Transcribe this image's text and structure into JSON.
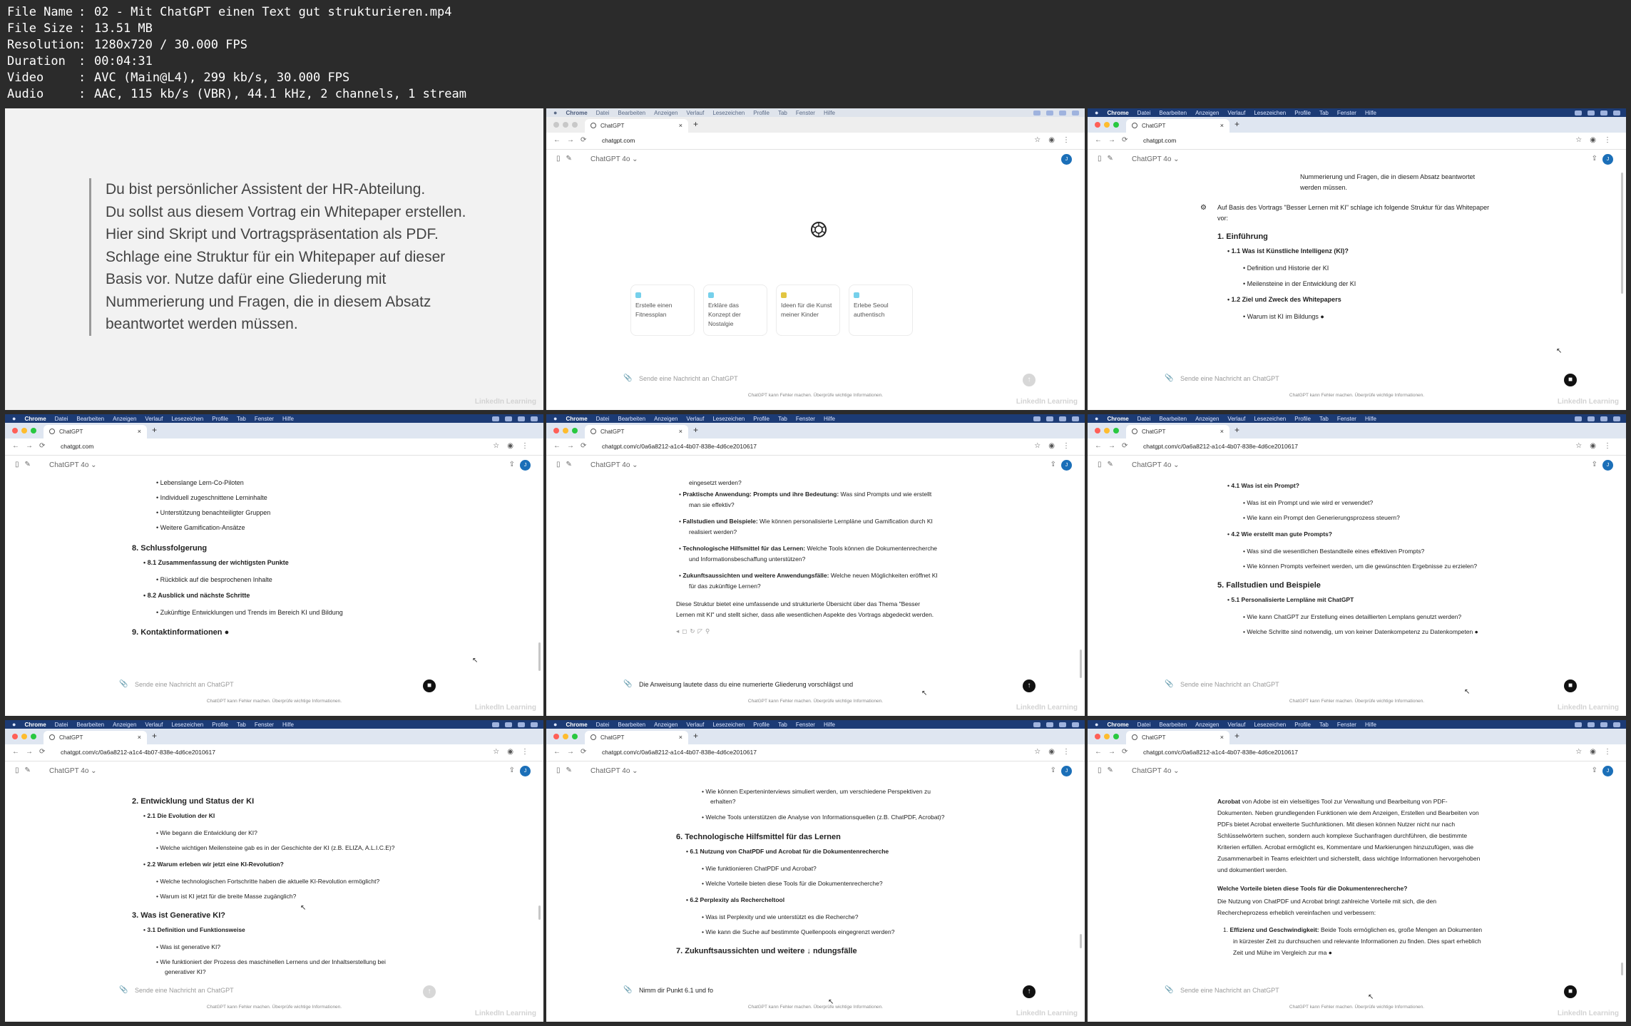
{
  "file_info": [
    {
      "key": "File Name",
      "value": "02 - Mit ChatGPT einen Text gut strukturieren.mp4"
    },
    {
      "key": "File Size",
      "value": "13.51 MB"
    },
    {
      "key": "Resolution",
      "value": "1280x720 / 30.000 FPS"
    },
    {
      "key": "Duration",
      "value": "00:04:31"
    },
    {
      "key": "Video",
      "value": "AVC (Main@L4), 299 kb/s, 30.000 FPS"
    },
    {
      "key": "Audio",
      "value": "AAC, 115 kb/s (VBR), 44.1 kHz, 2 channels, 1 stream"
    }
  ],
  "slide": {
    "lines": [
      "Du bist persönlicher Assistent der HR-Abteilung.",
      "Du sollst aus diesem Vortrag ein Whitepaper erstellen.",
      "Hier sind Skript und Vortragspräsentation als PDF.",
      "Schlage eine Struktur für ein Whitepaper auf dieser",
      "Basis vor. Nutze dafür eine Gliederung mit",
      "Nummerierung und Fragen, die in diesem Absatz",
      "beantwortet werden müssen."
    ]
  },
  "common": {
    "menubar": {
      "app": "Chrome",
      "items": [
        "Datei",
        "Bearbeiten",
        "Anzeigen",
        "Verlauf",
        "Lesezeichen",
        "Profile",
        "Tab",
        "Fenster",
        "Hilfe"
      ]
    },
    "tab_title": "ChatGPT",
    "model": "ChatGPT 4o",
    "avatar": "J",
    "placeholder": "Sende eine Nachricht an ChatGPT",
    "disclaimer": "ChatGPT kann Fehler machen. Überprüfe wichtige Informationen.",
    "watermark": "LinkedIn Learning",
    "url_home": "chatgpt.com",
    "url_chat": "chatgpt.com/c/0a6a8212-a1c4-4b07-838e-4d6ce2010617"
  },
  "frame2": {
    "suggestions": [
      {
        "text": "Erstelle einen Fitnessplan",
        "color": "#76d0eb"
      },
      {
        "text": "Erkläre das Konzept der Nostalgie",
        "color": "#76d0eb"
      },
      {
        "text": "Ideen für die Kunst meiner Kinder",
        "color": "#e2c541"
      },
      {
        "text": "Erlebe Seoul authentisch",
        "color": "#76d0eb"
      }
    ]
  },
  "frame3": {
    "user": [
      "Nummerierung und Fragen, die in diesem Absatz beantwortet",
      "werden müssen."
    ],
    "intro": [
      "Auf Basis des Vortrags \"Besser Lernen mit KI\" schlage ich folgende Struktur für das Whitepaper",
      "vor:"
    ],
    "h1": "1. Einführung",
    "s11": "1.1 Was ist Künstliche Intelligenz (KI)?",
    "b1": "Definition und Historie der KI",
    "b2": "Meilensteine in der Entwicklung der KI",
    "s12": "1.2 Ziel und Zweck des Whitepapers",
    "b3": "Warum ist KI im Bildungs"
  },
  "frame4": {
    "b1": "Lebenslange Lern-Co-Piloten",
    "b2": "Individuell zugeschnittene Lerninhalte",
    "b3": "Unterstützung benachteiligter Gruppen",
    "b4": "Weitere Gamification-Ansätze",
    "h8": "8. Schlussfolgerung",
    "s81": "8.1 Zusammenfassung der wichtigsten Punkte",
    "b5": "Rückblick auf die besprochenen Inhalte",
    "s82": "8.2 Ausblick und nächste Schritte",
    "b6": "Zukünftige Entwicklungen und Trends im Bereich KI und Bildung",
    "h9": "9. Kontaktinformationen"
  },
  "frame5": {
    "l0": "eingesetzt werden?",
    "p1b": "Praktische Anwendung: Prompts und ihre Bedeutung:",
    "p1t": " Was sind Prompts und wie erstellt",
    "p1c": "man sie effektiv?",
    "p2b": "Fallstudien und Beispiele:",
    "p2t": " Wie können personalisierte Lernpläne und Gamification durch KI",
    "p2c": "realisiert werden?",
    "p3b": "Technologische Hilfsmittel für das Lernen:",
    "p3t": " Welche Tools können die Dokumentenrecherche",
    "p3c": "und Informationsbeschaffung unterstützen?",
    "p4b": "Zukunftsaussichten und weitere Anwendungsfälle:",
    "p4t": " Welche neuen Möglichkeiten eröffnet KI",
    "p4c": "für das zukünftige Lernen?",
    "sum1": "Diese Struktur bietet eine umfassende und strukturierte Übersicht über das Thema \"Besser",
    "sum2": "Lernen mit KI\" und stellt sicher, dass alle wesentlichen Aspekte des Vortrags abgedeckt werden.",
    "typed": "Die Anweisung lautete dass du eine numerierte Gliederung vorschlägst und"
  },
  "frame6": {
    "s41": "4.1 Was ist ein Prompt?",
    "b1": "Was ist ein Prompt und wie wird er verwendet?",
    "b2": "Wie kann ein Prompt den Generierungsprozess steuern?",
    "s42": "4.2 Wie erstellt man gute Prompts?",
    "b3": "Was sind die wesentlichen Bestandteile eines effektiven Prompts?",
    "b4": "Wie können Prompts verfeinert werden, um die gewünschten Ergebnisse zu erzielen?",
    "h5": "5. Fallstudien und Beispiele",
    "s51": "5.1 Personalisierte Lernpläne mit ChatGPT",
    "b5": "Wie kann ChatGPT zur Erstellung eines detaillierten Lernplans genutzt werden?",
    "b6": "Welche Schritte sind notwendig, um von keiner Datenkompetenz zu Datenkompeten"
  },
  "frame7": {
    "h2": "2. Entwicklung und Status der KI",
    "s21": "2.1 Die Evolution der KI",
    "b1": "Wie begann die Entwicklung der KI?",
    "b2": "Welche wichtigen Meilensteine gab es in der Geschichte der KI (z.B. ELIZA, A.L.I.C.E)?",
    "s22": "2.2 Warum erleben wir jetzt eine KI-Revolution?",
    "b3": "Welche technologischen Fortschritte haben die aktuelle KI-Revolution ermöglicht?",
    "b4": "Warum ist KI jetzt für die breite Masse zugänglich?",
    "h3": "3. Was ist Generative KI?",
    "s31": "3.1 Definition und Funktionsweise",
    "b5": "Was ist generative KI?",
    "b6": "Wie funktioniert der Prozess des maschinellen Lernens und der Inhaltserstellung bei",
    "b6c": "generativer KI?"
  },
  "frame8": {
    "b1": "Wie können Experteninterviews simuliert werden, um verschiedene Perspektiven zu",
    "b1c": "erhalten?",
    "b2": "Welche Tools unterstützen die Analyse von Informationsquellen (z.B. ChatPDF, Acrobat)?",
    "h6": "6. Technologische Hilfsmittel für das Lernen",
    "s61": "6.1 Nutzung von ChatPDF und Acrobat für die Dokumentenrecherche",
    "b3": "Wie funktionieren ChatPDF und Acrobat?",
    "b4": "Welche Vorteile bieten diese Tools für die Dokumentenrecherche?",
    "s62": "6.2 Perplexity als Rechercheltool",
    "b5": "Was ist Perplexity und wie unterstützt es die Recherche?",
    "b6": "Wie kann die Suche auf bestimmte Quellenpools eingegrenzt werden?",
    "h7": "7. Zukunftsaussichten und weitere",
    "h7b": "ndungsfälle",
    "typed": "Nimm dir Punkt 6.1 und fo"
  },
  "frame9": {
    "p1a": "Acrobat",
    "p1": " von Adobe ist ein vielseitiges Tool zur Verwaltung und Bearbeitung von PDF-",
    "p2": "Dokumenten. Neben grundlegenden Funktionen wie dem Anzeigen, Erstellen und Bearbeiten von",
    "p3": "PDFs bietet Acrobat erweiterte Suchfunktionen. Mit diesen können Nutzer nicht nur nach",
    "p4": "Schlüsselwörtern suchen, sondern auch komplexe Suchanfragen durchführen, die bestimmte",
    "p5": "Kriterien erfüllen. Acrobat ermöglicht es, Kommentare und Markierungen hinzuzufügen, was die",
    "p6": "Zusammenarbeit in Teams erleichtert und sicherstellt, dass wichtige Informationen hervorgehoben",
    "p7": "und dokumentiert werden.",
    "q": "Welche Vorteile bieten diese Tools für die Dokumentenrecherche?",
    "r1": "Die Nutzung von ChatPDF und Acrobat bringt zahlreiche Vorteile mit sich, die den",
    "r2": "Rechercheprozess erheblich vereinfachen und verbessern:",
    "n1b": "Effizienz und Geschwindigkeit:",
    "n1": " Beide Tools ermöglichen es, große Mengen an Dokumenten",
    "n2": "in kürzester Zeit zu durchsuchen und relevante Informationen zu finden. Dies spart erheblich",
    "n3": "Zeit und Mühe im Vergleich zur ma"
  }
}
